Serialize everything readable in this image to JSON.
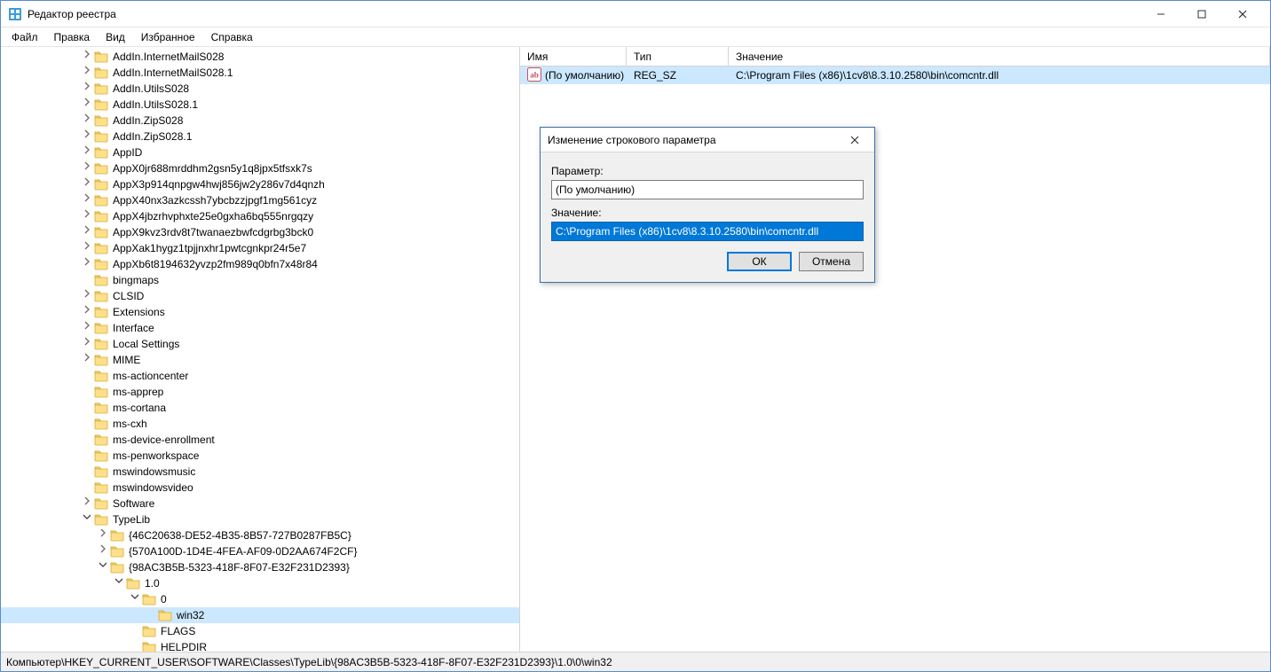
{
  "window": {
    "title": "Редактор реестра"
  },
  "menu": {
    "file": "Файл",
    "edit": "Правка",
    "view": "Вид",
    "favorites": "Избранное",
    "help": "Справка"
  },
  "tree": {
    "items": [
      {
        "depth": 5,
        "toggle": ">",
        "label": "AddIn.InternetMailS028"
      },
      {
        "depth": 5,
        "toggle": ">",
        "label": "AddIn.InternetMailS028.1"
      },
      {
        "depth": 5,
        "toggle": ">",
        "label": "AddIn.UtilsS028"
      },
      {
        "depth": 5,
        "toggle": ">",
        "label": "AddIn.UtilsS028.1"
      },
      {
        "depth": 5,
        "toggle": ">",
        "label": "AddIn.ZipS028"
      },
      {
        "depth": 5,
        "toggle": ">",
        "label": "AddIn.ZipS028.1"
      },
      {
        "depth": 5,
        "toggle": ">",
        "label": "AppID"
      },
      {
        "depth": 5,
        "toggle": ">",
        "label": "AppX0jr688mrddhm2gsn5y1q8jpx5tfsxk7s"
      },
      {
        "depth": 5,
        "toggle": ">",
        "label": "AppX3p914qnpgw4hwj856jw2y286v7d4qnzh"
      },
      {
        "depth": 5,
        "toggle": ">",
        "label": "AppX40nx3azkcssh7ybcbzzjpgf1mg561cyz"
      },
      {
        "depth": 5,
        "toggle": ">",
        "label": "AppX4jbzrhvphxte25e0gxha6bq555nrgqzy"
      },
      {
        "depth": 5,
        "toggle": ">",
        "label": "AppX9kvz3rdv8t7twanaezbwfcdgrbg3bck0"
      },
      {
        "depth": 5,
        "toggle": ">",
        "label": "AppXak1hygz1tpjjnxhr1pwtcgnkpr24r5e7"
      },
      {
        "depth": 5,
        "toggle": ">",
        "label": "AppXb6t8194632yvzp2fm989q0bfn7x48r84"
      },
      {
        "depth": 5,
        "toggle": "",
        "label": "bingmaps"
      },
      {
        "depth": 5,
        "toggle": ">",
        "label": "CLSID"
      },
      {
        "depth": 5,
        "toggle": ">",
        "label": "Extensions"
      },
      {
        "depth": 5,
        "toggle": ">",
        "label": "Interface"
      },
      {
        "depth": 5,
        "toggle": ">",
        "label": "Local Settings"
      },
      {
        "depth": 5,
        "toggle": ">",
        "label": "MIME"
      },
      {
        "depth": 5,
        "toggle": "",
        "label": "ms-actioncenter"
      },
      {
        "depth": 5,
        "toggle": "",
        "label": "ms-apprep"
      },
      {
        "depth": 5,
        "toggle": "",
        "label": "ms-cortana"
      },
      {
        "depth": 5,
        "toggle": "",
        "label": "ms-cxh"
      },
      {
        "depth": 5,
        "toggle": "",
        "label": "ms-device-enrollment"
      },
      {
        "depth": 5,
        "toggle": "",
        "label": "ms-penworkspace"
      },
      {
        "depth": 5,
        "toggle": "",
        "label": "mswindowsmusic"
      },
      {
        "depth": 5,
        "toggle": "",
        "label": "mswindowsvideo"
      },
      {
        "depth": 5,
        "toggle": ">",
        "label": "Software"
      },
      {
        "depth": 5,
        "toggle": "v",
        "label": "TypeLib"
      },
      {
        "depth": 6,
        "toggle": ">",
        "label": "{46C20638-DE52-4B35-8B57-727B0287FB5C}"
      },
      {
        "depth": 6,
        "toggle": ">",
        "label": "{570A100D-1D4E-4FEA-AF09-0D2AA674F2CF}"
      },
      {
        "depth": 6,
        "toggle": "v",
        "label": "{98AC3B5B-5323-418F-8F07-E32F231D2393}"
      },
      {
        "depth": 7,
        "toggle": "v",
        "label": "1.0"
      },
      {
        "depth": 8,
        "toggle": "v",
        "label": "0"
      },
      {
        "depth": 9,
        "toggle": "",
        "label": "win32",
        "selected": true
      },
      {
        "depth": 8,
        "toggle": "",
        "label": "FLAGS"
      },
      {
        "depth": 8,
        "toggle": "",
        "label": "HELPDIR"
      }
    ]
  },
  "values": {
    "headers": {
      "name": "Имя",
      "type": "Тип",
      "value": "Значение"
    },
    "rows": [
      {
        "name": "(По умолчанию)",
        "type": "REG_SZ",
        "value": "C:\\Program Files (x86)\\1cv8\\8.3.10.2580\\bin\\comcntr.dll"
      }
    ]
  },
  "dialog": {
    "title": "Изменение строкового параметра",
    "param_label": "Параметр:",
    "param_value": "(По умолчанию)",
    "value_label": "Значение:",
    "value_value": "C:\\Program Files (x86)\\1cv8\\8.3.10.2580\\bin\\comcntr.dll",
    "ok": "ОК",
    "cancel": "Отмена"
  },
  "status": {
    "path": "Компьютер\\HKEY_CURRENT_USER\\SOFTWARE\\Classes\\TypeLib\\{98AC3B5B-5323-418F-8F07-E32F231D2393}\\1.0\\0\\win32"
  }
}
